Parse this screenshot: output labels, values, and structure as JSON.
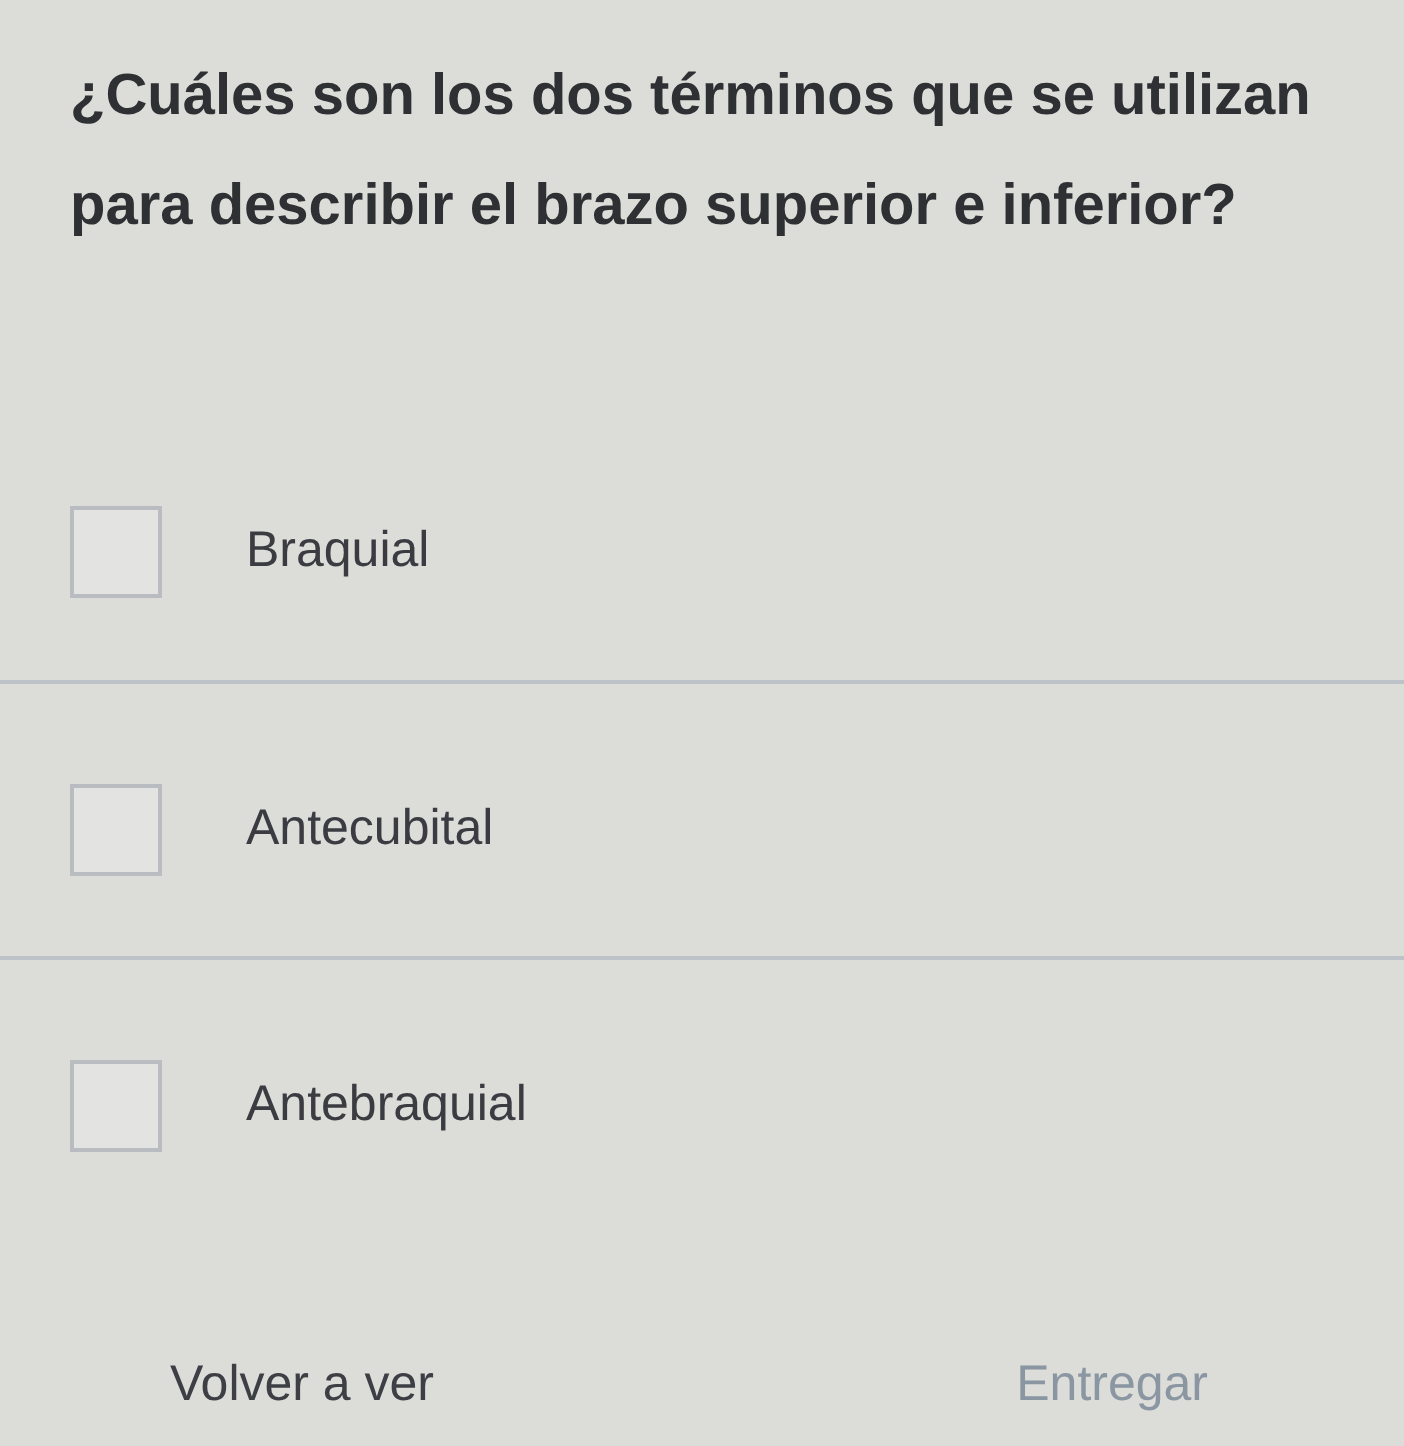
{
  "question": "¿Cuáles son los dos términos que se utilizan para describir el brazo superior e inferior?",
  "options": [
    {
      "label": "Braquial",
      "checked": false
    },
    {
      "label": "Antecubital",
      "checked": false
    },
    {
      "label": "Antebraquial",
      "checked": false
    }
  ],
  "buttons": [
    {
      "label": "Volver a ver",
      "disabled": false
    },
    {
      "label": "Entregar",
      "disabled": true
    }
  ]
}
